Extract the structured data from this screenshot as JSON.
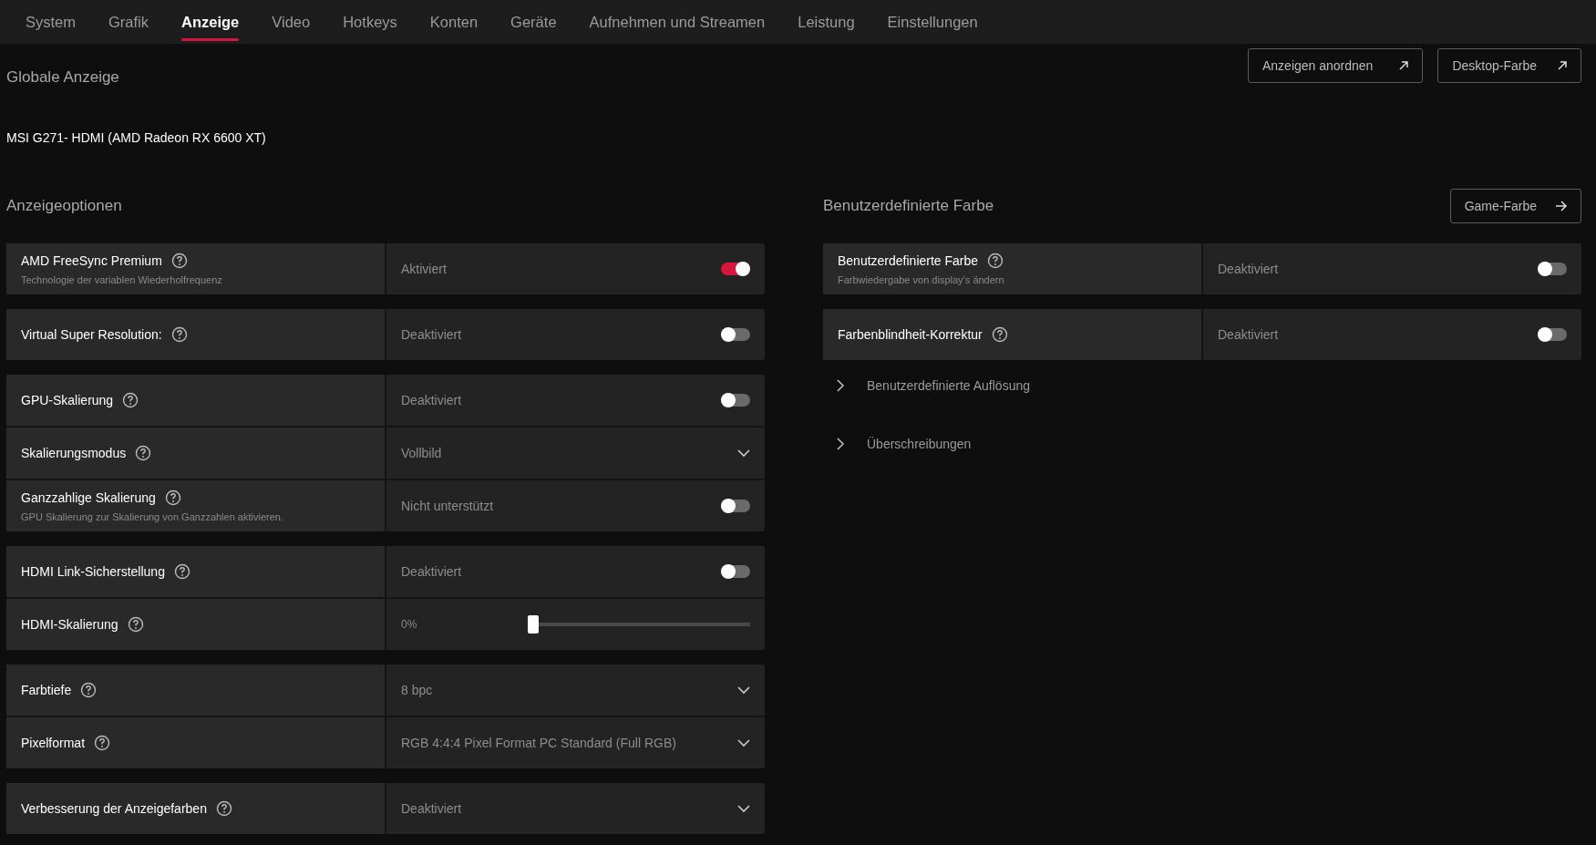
{
  "tabs": [
    {
      "label": "System",
      "selected": false
    },
    {
      "label": "Grafik",
      "selected": false
    },
    {
      "label": "Anzeige",
      "selected": true
    },
    {
      "label": "Video",
      "selected": false
    },
    {
      "label": "Hotkeys",
      "selected": false
    },
    {
      "label": "Konten",
      "selected": false
    },
    {
      "label": "Geräte",
      "selected": false
    },
    {
      "label": "Aufnehmen und Streamen",
      "selected": false
    },
    {
      "label": "Leistung",
      "selected": false
    },
    {
      "label": "Einstellungen",
      "selected": false
    }
  ],
  "header": {
    "title": "Globale Anzeige",
    "buttons": [
      {
        "label": "Anzeigen anordnen"
      },
      {
        "label": "Desktop-Farbe"
      }
    ]
  },
  "display_name": "MSI G271- HDMI (AMD Radeon RX 6600 XT)",
  "left": {
    "title": "Anzeigeoptionen",
    "groups": [
      {
        "rows": [
          {
            "kind": "toggle",
            "label": "AMD FreeSync Premium",
            "description": "Technologie der variablen Wiederholfrequenz",
            "value": "Aktiviert",
            "on": true
          }
        ]
      },
      {
        "rows": [
          {
            "kind": "toggle",
            "label": "Virtual Super Resolution:",
            "value": "Deaktiviert",
            "on": false
          }
        ]
      },
      {
        "rows": [
          {
            "kind": "toggle",
            "label": "GPU-Skalierung",
            "value": "Deaktiviert",
            "on": false
          },
          {
            "kind": "dropdown",
            "label": "Skalierungsmodus",
            "value": "Vollbild"
          },
          {
            "kind": "toggle",
            "label": "Ganzzahlige Skalierung",
            "description": "GPU Skalierung zur Skalierung von Ganzzahlen aktivieren.",
            "value": "Nicht unterstützt",
            "on": false
          }
        ]
      },
      {
        "rows": [
          {
            "kind": "toggle",
            "label": "HDMI Link-Sicherstellung",
            "value": "Deaktiviert",
            "on": false
          },
          {
            "kind": "slider",
            "label": "HDMI-Skalierung",
            "value": "0%",
            "level": 0
          }
        ]
      },
      {
        "rows": [
          {
            "kind": "dropdown",
            "label": "Farbtiefe",
            "value": "8 bpc"
          },
          {
            "kind": "dropdown",
            "label": "Pixelformat",
            "value": "RGB 4:4:4 Pixel Format PC Standard (Full RGB)"
          }
        ]
      },
      {
        "rows": [
          {
            "kind": "dropdown",
            "label": "Verbesserung der Anzeigefarben",
            "value": "Deaktiviert"
          }
        ]
      }
    ]
  },
  "right": {
    "title": "Benutzerdefinierte Farbe",
    "button": {
      "label": "Game-Farbe"
    },
    "groups": [
      {
        "rows": [
          {
            "kind": "toggle",
            "label": "Benutzerdefinierte Farbe",
            "description": "Farbwiedergabe von display’s ändern",
            "value": "Deaktiviert",
            "on": false
          }
        ]
      },
      {
        "rows": [
          {
            "kind": "toggle",
            "label": "Farbenblindheit-Korrektur",
            "value": "Deaktiviert",
            "on": false
          }
        ]
      }
    ],
    "expanders": [
      {
        "label": "Benutzerdefinierte Auflösung",
        "expanded": false
      },
      {
        "label": "Überschreibungen",
        "expanded": false
      }
    ]
  }
}
